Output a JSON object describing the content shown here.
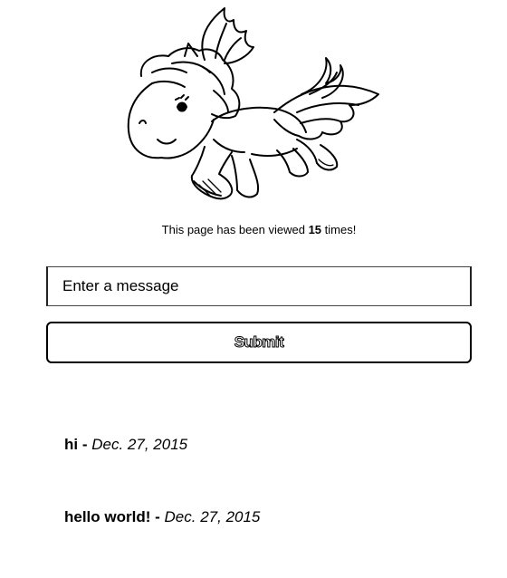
{
  "view_counter": {
    "prefix": "This page has been viewed",
    "count": "15",
    "suffix": "times!"
  },
  "form": {
    "message_placeholder": "Enter a message",
    "submit_label": "Submit"
  },
  "messages": [
    {
      "text": "hi",
      "separator": "-",
      "date": "Dec. 27, 2015"
    },
    {
      "text": "hello world!",
      "separator": "-",
      "date": "Dec. 27, 2015"
    }
  ],
  "icons": {
    "unicorn": "unicorn-pegasus-illustration"
  }
}
